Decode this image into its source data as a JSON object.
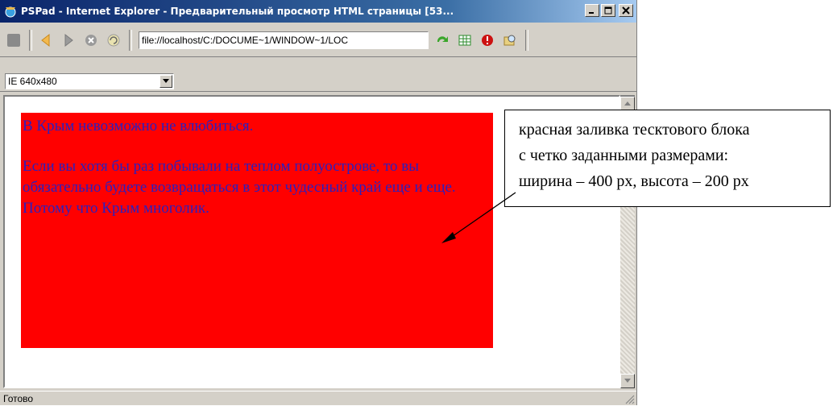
{
  "window": {
    "title": "PSPad - Internet Explorer - Предварительный просмотр HTML страницы   [53..."
  },
  "toolbar": {
    "address": "file://localhost/C:/DOCUME~1/WINDOW~1/LOC"
  },
  "preview": {
    "size_option": "IE 640x480"
  },
  "page": {
    "heading": "В Крым невозможно не влюбиться.",
    "paragraph": "Если вы хотя бы раз побывали на теплом полуострове, то вы обязательно будете возвращаться в этот чудесный край еще и еще. Потому что Крым многолик."
  },
  "status": {
    "text": "Готово"
  },
  "callout": {
    "line1": "красная заливка тесктового блока",
    "line2": "с четко заданными размерами:",
    "line3": "ширина – 400 px, высота – 200 px"
  },
  "colors": {
    "block_fill": "#ff0000",
    "block_text": "#2a1fbf",
    "titlebar": "#0a246a"
  },
  "icons": [
    "stop-icon",
    "back-icon",
    "forward-icon",
    "cancel-icon",
    "refresh-icon",
    "go-icon",
    "grid-icon",
    "error-icon",
    "search-icon",
    "app-icon"
  ]
}
